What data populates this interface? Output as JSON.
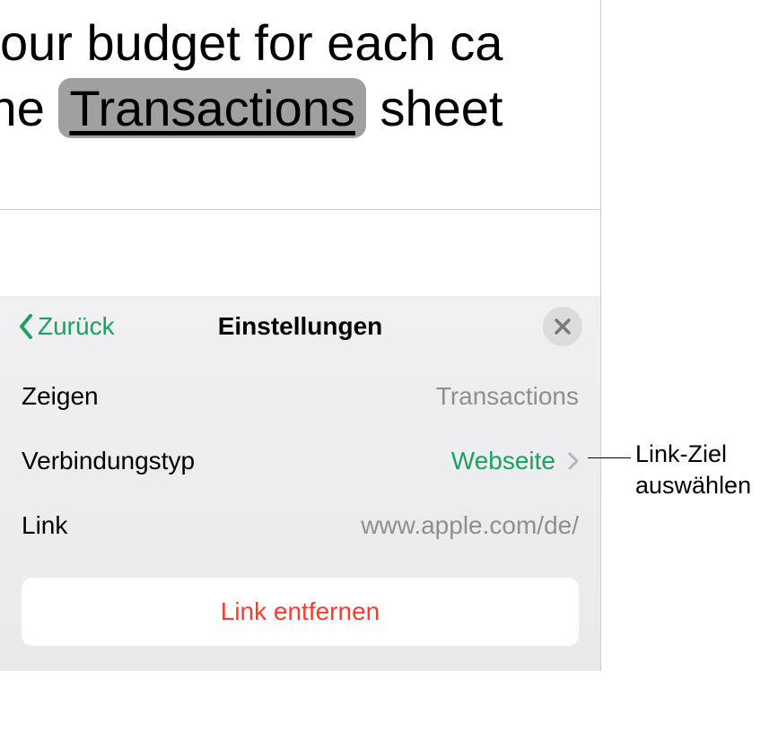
{
  "content": {
    "line1_before": "your budget for each ca",
    "line2_before": " the ",
    "highlighted": "Transactions",
    "line2_after": " sheet "
  },
  "panel": {
    "back_label": "Zurück",
    "title": "Einstellungen",
    "rows": {
      "display": {
        "label": "Zeigen",
        "value": "Transactions"
      },
      "link_type": {
        "label": "Verbindungstyp",
        "value": "Webseite"
      },
      "link": {
        "label": "Link",
        "value": "www.apple.com/de/"
      }
    },
    "remove_label": "Link entfernen"
  },
  "callout": {
    "line1": "Link-Ziel",
    "line2": "auswählen"
  }
}
